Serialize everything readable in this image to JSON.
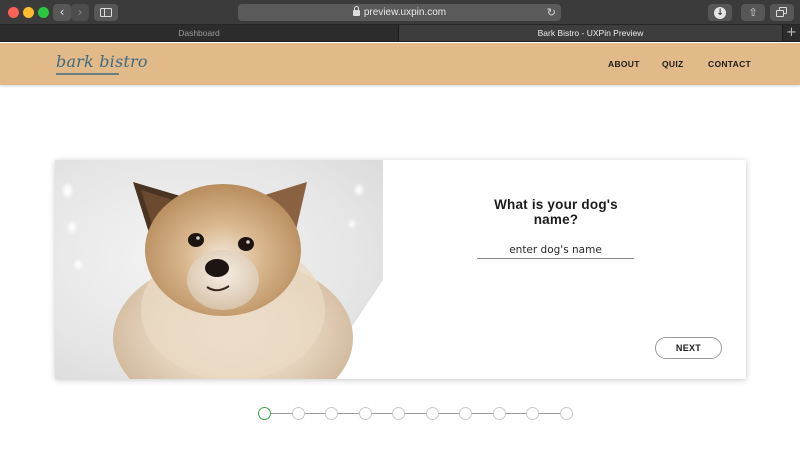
{
  "browser": {
    "url": "preview.uxpin.com",
    "tabs": [
      {
        "label": "Dashboard",
        "active": false
      },
      {
        "label": "Bark Bistro - UXPin Preview",
        "active": true
      }
    ],
    "new_tab_label": "+"
  },
  "site": {
    "logo": "bark bistro",
    "brand_color": "#e2b989",
    "logo_color": "#3f6b80",
    "nav": [
      {
        "label": "ABOUT"
      },
      {
        "label": "QUIZ"
      },
      {
        "label": "CONTACT"
      }
    ]
  },
  "quiz": {
    "photo": "pomeranian-dog-photo",
    "question": "What is your dog's name?",
    "input_placeholder": "enter dog's name",
    "input_value": "",
    "next_label": "NEXT",
    "progress": {
      "total_steps": 10,
      "current_step": 1,
      "active_color": "#3aa54a"
    }
  },
  "icons": {
    "back": "chevron-left-icon",
    "forward": "chevron-right-icon",
    "sidebar": "sidebar-icon",
    "lock": "lock-icon",
    "reload": "reload-icon",
    "download": "download-icon",
    "share": "share-icon",
    "tabs": "tabs-overview-icon"
  }
}
